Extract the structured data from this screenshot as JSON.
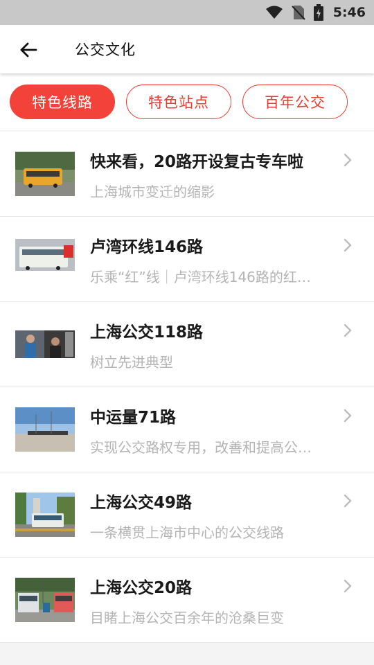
{
  "status_bar": {
    "time": "5:46",
    "icons": [
      "wifi-icon",
      "no-sim-icon",
      "battery-charging-icon"
    ]
  },
  "header": {
    "back_icon": "arrow-left-icon",
    "title": "公交文化"
  },
  "tabs": [
    {
      "label": "特色线路",
      "active": true
    },
    {
      "label": "特色站点",
      "active": false
    },
    {
      "label": "百年公交",
      "active": false
    }
  ],
  "colors": {
    "accent": "#f2423a",
    "title_text": "#1a1a1a",
    "subtitle_text": "#b4b4b4"
  },
  "list": {
    "items": [
      {
        "title": "快来看，20路开设复古专车啦",
        "subtitle": "上海城市变迁的缩影",
        "thumbnail": "yellow-vintage-bus-photo"
      },
      {
        "title": "卢湾环线146路",
        "subtitle": "乐乘“红”线｜卢湾环线146路的红…",
        "thumbnail": "white-bus-street-photo"
      },
      {
        "title": "上海公交118路",
        "subtitle": "树立先进典型",
        "thumbnail": "bus-staff-photo"
      },
      {
        "title": "中运量71路",
        "subtitle": "实现公交路权专用，改善和提高公…",
        "thumbnail": "bus-depot-sky-photo"
      },
      {
        "title": "上海公交49路",
        "subtitle": "一条横贯上海市中心的公交线路",
        "thumbnail": "city-bus-trees-photo"
      },
      {
        "title": "上海公交20路",
        "subtitle": "目睹上海公交百余年的沧桑巨变",
        "thumbnail": "trolleybus-street-photo"
      }
    ],
    "chevron_icon": "chevron-right-icon"
  }
}
